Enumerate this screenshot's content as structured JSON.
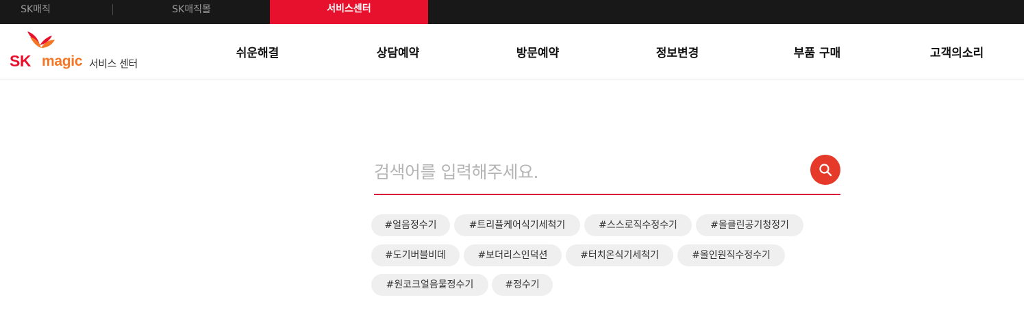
{
  "topbar": {
    "sites": [
      "SK매직",
      "SK매직몰",
      "서비스센터"
    ],
    "active_site": "서비스센터"
  },
  "logo": {
    "brand_sk": "SK",
    "brand_magic": "magic",
    "subtitle": "서비스 센터"
  },
  "nav": {
    "items": [
      {
        "label": "쉬운해결"
      },
      {
        "label": "상담예약"
      },
      {
        "label": "방문예약"
      },
      {
        "label": "정보변경"
      },
      {
        "label": "부품 구매"
      },
      {
        "label": "고객의소리"
      }
    ]
  },
  "search": {
    "placeholder": "검색어를 입력해주세요.",
    "value": "",
    "button_icon": "search-icon"
  },
  "tags": [
    "#얼음정수기",
    "#트리플케어식기세척기",
    "#스스로직수정수기",
    "#올클린공기청정기",
    "#도기버블비데",
    "#보더리스인덕션",
    "#터치온식기세척기",
    "#올인원직수정수기",
    "#원코크얼음물정수기",
    "#정수기"
  ],
  "colors": {
    "accent": "#e8112d",
    "search_button": "#e53a2a",
    "brand_orange": "#f47725",
    "topbar_bg": "#181818",
    "tag_bg": "#efefef"
  }
}
